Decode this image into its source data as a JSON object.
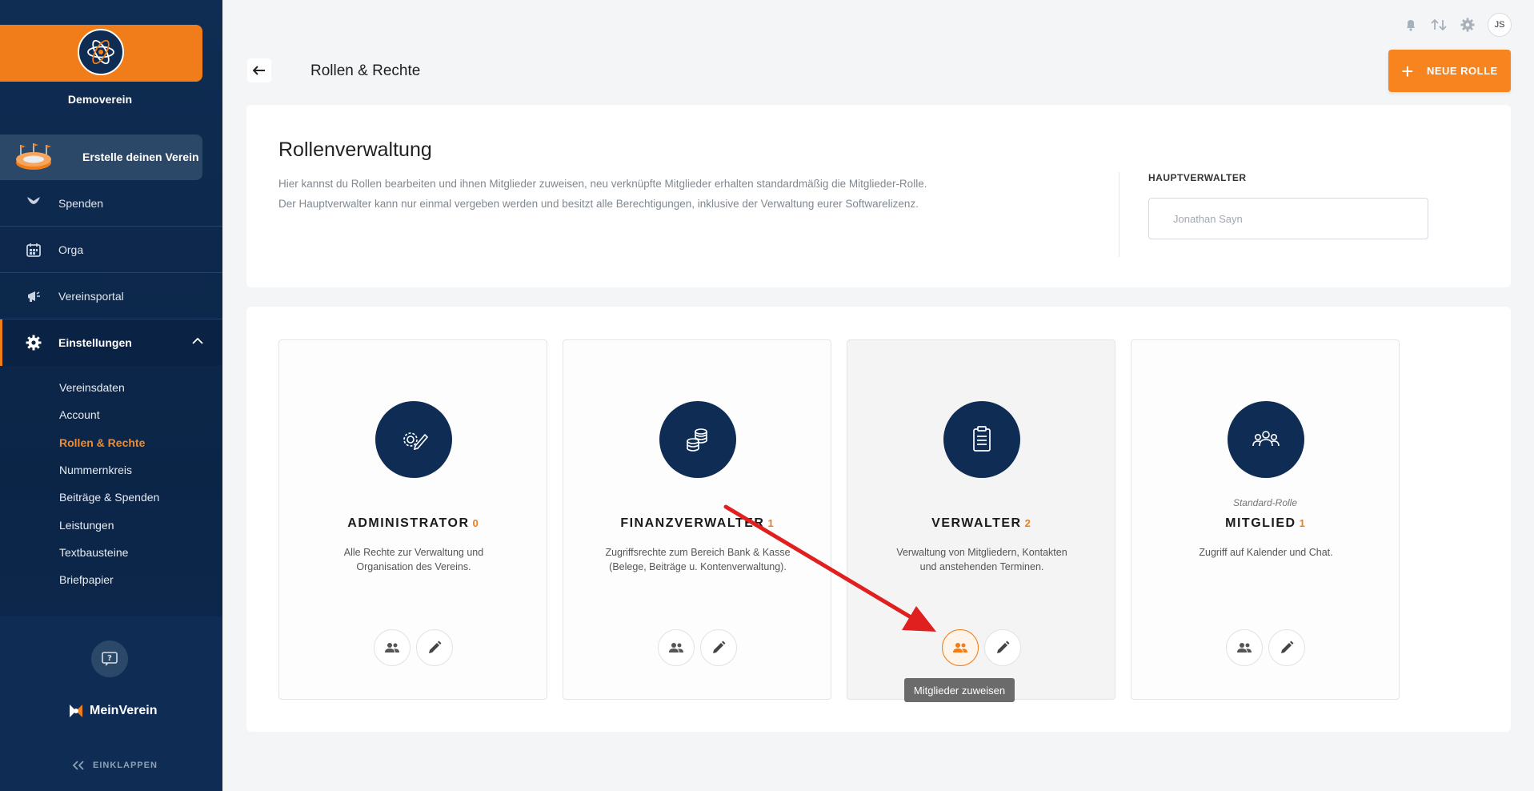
{
  "sidebar": {
    "club_name": "Demoverein",
    "promo_label": "Erstelle deinen Verein",
    "nav": [
      {
        "label": "Spenden",
        "icon": "hands-heart-icon"
      },
      {
        "label": "Orga",
        "icon": "calendar-grid-icon"
      },
      {
        "label": "Vereinsportal",
        "icon": "megaphone-icon"
      },
      {
        "label": "Einstellungen",
        "icon": "gear-icon"
      }
    ],
    "subnav": [
      "Vereinsdaten",
      "Account",
      "Rollen & Rechte",
      "Nummernkreis",
      "Beiträge & Spenden",
      "Leistungen",
      "Textbausteine",
      "Briefpapier"
    ],
    "brand": "MeinVerein",
    "collapse_label": "EINKLAPPEN"
  },
  "topbar": {
    "avatar_initials": "JS"
  },
  "header": {
    "page_title": "Rollen & Rechte",
    "new_role_label": "NEUE ROLLE"
  },
  "info": {
    "title": "Rollenverwaltung",
    "desc_line1": "Hier kannst du Rollen bearbeiten und ihnen Mitglieder zuweisen, neu verknüpfte Mitglieder erhalten standardmäßig die Mitglieder-Rolle.",
    "desc_line2": "Der Hauptverwalter kann nur einmal vergeben werden und besitzt alle Berechtigungen, inklusive der Verwaltung eurer Softwarelizenz.",
    "main_admin_label": "HAUPTVERWALTER",
    "main_admin_value": "Jonathan Sayn"
  },
  "roles": [
    {
      "name": "ADMINISTRATOR",
      "count": "0",
      "std": "",
      "desc": "Alle Rechte zur Verwaltung und Organisation des Vereins."
    },
    {
      "name": "FINANZVERWALTER",
      "count": "1",
      "std": "",
      "desc": "Zugriffsrechte zum Bereich Bank & Kasse (Belege, Beiträge u. Kontenverwaltung)."
    },
    {
      "name": "VERWALTER",
      "count": "2",
      "std": "",
      "desc": "Verwaltung von Mitgliedern, Kontakten und anstehenden Terminen."
    },
    {
      "name": "MITGLIED",
      "count": "1",
      "std": "Standard-Rolle",
      "desc": "Zugriff auf Kalender und Chat."
    }
  ],
  "tooltip": "Mitglieder zuweisen",
  "colors": {
    "accent": "#f7841f",
    "navy": "#0e2c54",
    "annotation_arrow": "#e0201f"
  }
}
